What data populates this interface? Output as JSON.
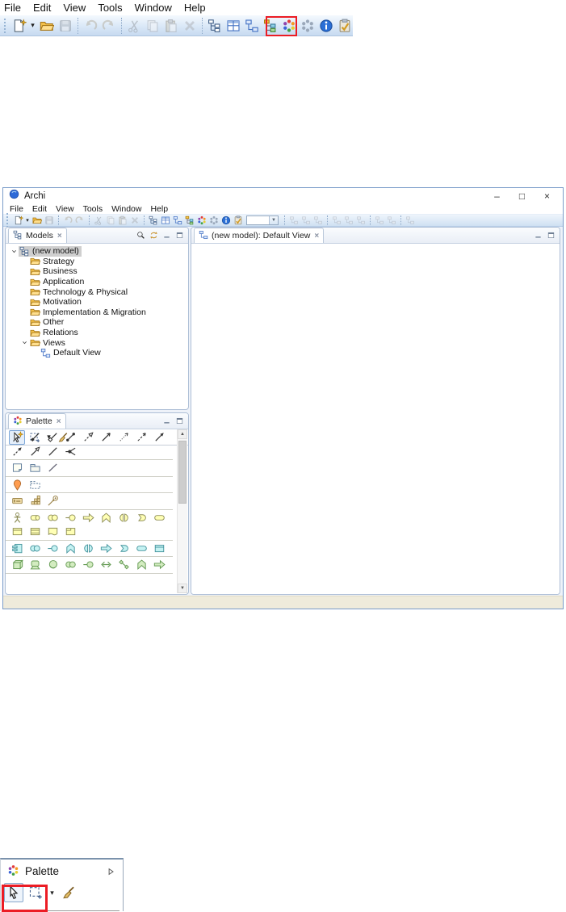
{
  "colors": {
    "highlight_red": "#ec1c24",
    "window_border": "#7a9cc9",
    "selection_grey": "#cfcfcf",
    "business_fill": "#ffffb5",
    "application_fill": "#c5f2f2",
    "technology_fill": "#d3ecc0",
    "strategy_fill": "#f3e0ac",
    "location_orange": "#ff9d50",
    "folder_gold": "#f5c24a",
    "info_blue": "#2a6fd6",
    "status_beige": "#efebdb"
  },
  "top_fragment": {
    "menu": [
      "File",
      "Edit",
      "View",
      "Tools",
      "Window",
      "Help"
    ],
    "toolbar": [
      {
        "name": "new-model"
      },
      {
        "name": "new-dropdown"
      },
      {
        "name": "open-model"
      },
      {
        "name": "save",
        "disabled": true
      },
      {
        "sep": true
      },
      {
        "name": "undo",
        "disabled": true
      },
      {
        "name": "redo",
        "disabled": true
      },
      {
        "sep": true
      },
      {
        "name": "cut",
        "disabled": true
      },
      {
        "name": "copy",
        "disabled": true
      },
      {
        "name": "paste",
        "disabled": true
      },
      {
        "name": "delete",
        "disabled": true
      },
      {
        "sep": true
      },
      {
        "name": "models-view"
      },
      {
        "name": "properties-view"
      },
      {
        "name": "outline-view"
      },
      {
        "name": "navigator-view"
      },
      {
        "name": "canvas-view",
        "highlight": true
      },
      {
        "name": "sketch-view"
      },
      {
        "name": "hints-view"
      },
      {
        "name": "validator"
      }
    ]
  },
  "window": {
    "title": "Archi",
    "controls": [
      "minimize",
      "maximize",
      "close"
    ],
    "menu": [
      "File",
      "Edit",
      "View",
      "Tools",
      "Window",
      "Help"
    ],
    "toolbar": {
      "items": [
        {
          "name": "new-model"
        },
        {
          "name": "new-dropdown"
        },
        {
          "name": "open-model"
        },
        {
          "name": "save",
          "disabled": true
        },
        {
          "sep": true
        },
        {
          "name": "undo",
          "disabled": true
        },
        {
          "name": "redo",
          "disabled": true
        },
        {
          "sep": true
        },
        {
          "name": "cut",
          "disabled": true
        },
        {
          "name": "copy",
          "disabled": true
        },
        {
          "name": "paste",
          "disabled": true
        },
        {
          "name": "delete",
          "disabled": true
        },
        {
          "sep": true
        },
        {
          "name": "models-view"
        },
        {
          "name": "properties-view"
        },
        {
          "name": "outline-view"
        },
        {
          "name": "navigator-view"
        },
        {
          "name": "canvas-view"
        },
        {
          "name": "sketch-view"
        },
        {
          "name": "hints-view"
        },
        {
          "name": "validator"
        },
        {
          "name": "zoom-combo",
          "value": ""
        },
        {
          "sep": true
        },
        {
          "name": "ghost",
          "disabled": true
        },
        {
          "name": "ghost",
          "disabled": true
        },
        {
          "name": "ghost",
          "disabled": true
        },
        {
          "sep": true
        },
        {
          "name": "ghost",
          "disabled": true
        },
        {
          "name": "ghost",
          "disabled": true
        },
        {
          "name": "ghost",
          "disabled": true
        },
        {
          "sep": true
        },
        {
          "name": "ghost",
          "disabled": true
        },
        {
          "name": "ghost",
          "disabled": true
        },
        {
          "sep": true
        },
        {
          "name": "ghost",
          "disabled": true
        }
      ]
    },
    "models_panel": {
      "tab": "Models",
      "toolbar": [
        "search",
        "link-with-editor",
        "minimize",
        "maximize"
      ],
      "tree": [
        {
          "label": "(new model)",
          "icon": "model",
          "level": 0,
          "chevron": true,
          "selected": true
        },
        {
          "label": "Strategy",
          "icon": "folder",
          "level": 1
        },
        {
          "label": "Business",
          "icon": "folder",
          "level": 1
        },
        {
          "label": "Application",
          "icon": "folder",
          "level": 1
        },
        {
          "label": "Technology & Physical",
          "icon": "folder",
          "level": 1
        },
        {
          "label": "Motivation",
          "icon": "folder",
          "level": 1
        },
        {
          "label": "Implementation & Migration",
          "icon": "folder",
          "level": 1
        },
        {
          "label": "Other",
          "icon": "folder",
          "level": 1
        },
        {
          "label": "Relations",
          "icon": "folder",
          "level": 1
        },
        {
          "label": "Views",
          "icon": "folder",
          "level": 1,
          "chevron": true
        },
        {
          "label": "Default View",
          "icon": "diagram",
          "level": 2
        }
      ]
    },
    "palette_panel": {
      "tab": "Palette",
      "buttons": [
        "minimize",
        "maximize"
      ],
      "tools": [
        {
          "name": "cursor",
          "selected": true
        },
        {
          "name": "marquee"
        },
        {
          "name": "marquee-dropdown"
        },
        {
          "name": "format-painter"
        }
      ],
      "sections": [
        {
          "rows": [
            [
              "magic-connector",
              "composition",
              "aggregation",
              "assignment",
              "realization",
              "serving",
              "access",
              "influence",
              "triggering"
            ],
            [
              "flow",
              "specialization",
              "association",
              "junction"
            ]
          ]
        },
        {
          "rows": [
            [
              "note",
              "group",
              "connection-line"
            ]
          ]
        },
        {
          "rows": [
            [
              "location",
              "grouping"
            ]
          ]
        },
        {
          "rows": [
            [
              "resource",
              "capability",
              "course-of-action"
            ]
          ]
        },
        {
          "rows": [
            [
              "business-actor",
              "business-role",
              "business-collaboration",
              "business-interface",
              "business-process",
              "business-function",
              "business-interaction",
              "business-event",
              "business-service"
            ],
            [
              "business-object",
              "contract",
              "representation",
              "product"
            ]
          ]
        },
        {
          "rows": [
            [
              "application-component",
              "application-collaboration",
              "application-interface",
              "application-function",
              "application-interaction",
              "application-process",
              "application-event",
              "application-service",
              "data-object"
            ]
          ]
        },
        {
          "rows": [
            [
              "node",
              "device",
              "system-software",
              "technology-collaboration",
              "technology-interface",
              "path",
              "communication-network",
              "technology-function",
              "technology-process"
            ]
          ]
        },
        {
          "rows": [
            [
              "cutoff",
              "cutoff",
              "cutoff",
              "cutoff"
            ]
          ],
          "cut": true
        }
      ]
    },
    "editor": {
      "tab": "(new model): Default View",
      "buttons": [
        "minimize",
        "maximize"
      ]
    }
  },
  "bottom_fragment": {
    "tab": "Palette",
    "expand": "expand-right",
    "tools": [
      {
        "name": "cursor",
        "selected": true
      },
      {
        "name": "marquee"
      },
      {
        "name": "marquee-dropdown"
      },
      {
        "name": "format-painter"
      }
    ]
  }
}
